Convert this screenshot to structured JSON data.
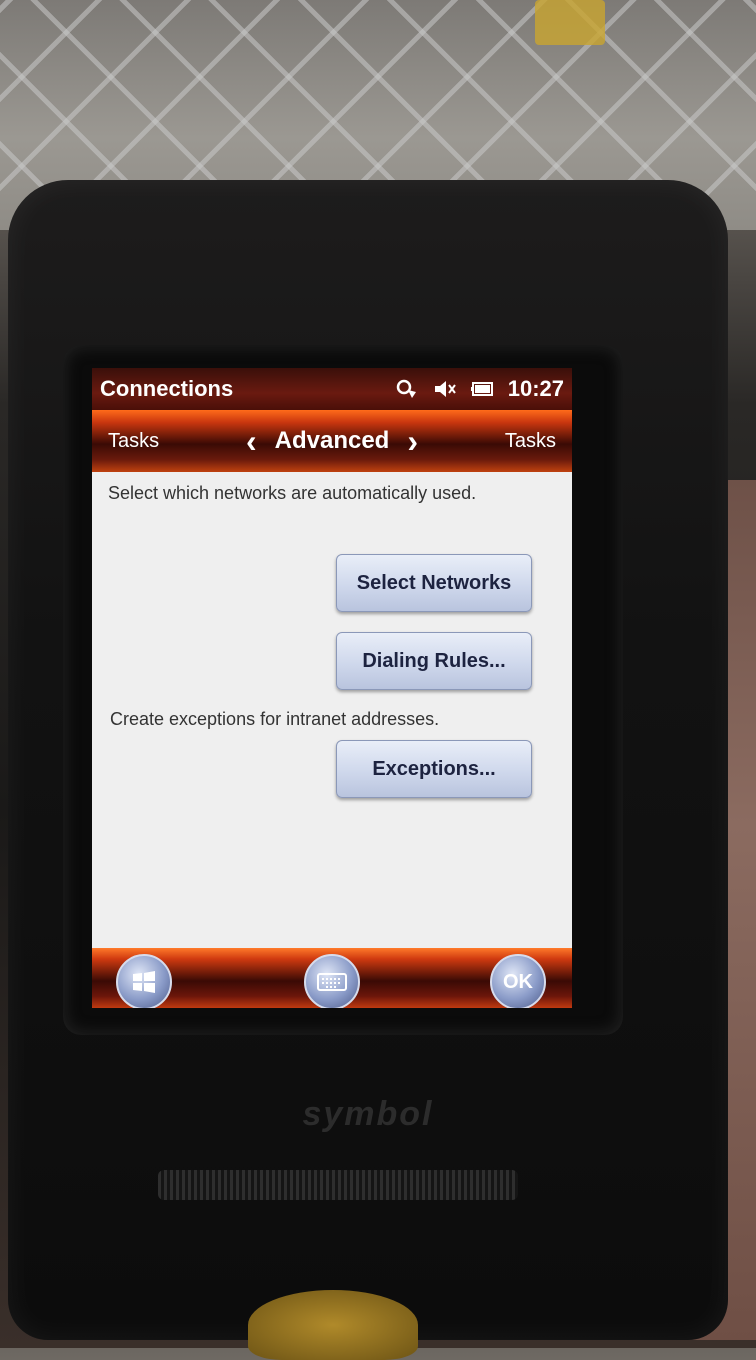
{
  "window": {
    "title": "Connections"
  },
  "status": {
    "time": "10:27",
    "icons": [
      "connectivity-icon",
      "volume-muted-icon",
      "battery-icon"
    ]
  },
  "nav": {
    "left_label": "Tasks",
    "title": "Advanced",
    "right_label": "Tasks"
  },
  "content": {
    "networks_text": "Select which networks are automatically used.",
    "select_networks_button": "Select Networks",
    "dialing_rules_button": "Dialing Rules...",
    "exceptions_text": "Create exceptions for intranet addresses.",
    "exceptions_button": "Exceptions..."
  },
  "softkeys": {
    "ok_label": "OK"
  },
  "device": {
    "brand": "symbol"
  },
  "colors": {
    "accent_orange": "#d03a10",
    "title_dark": "#4a0f08",
    "button_text": "#1d2340"
  }
}
